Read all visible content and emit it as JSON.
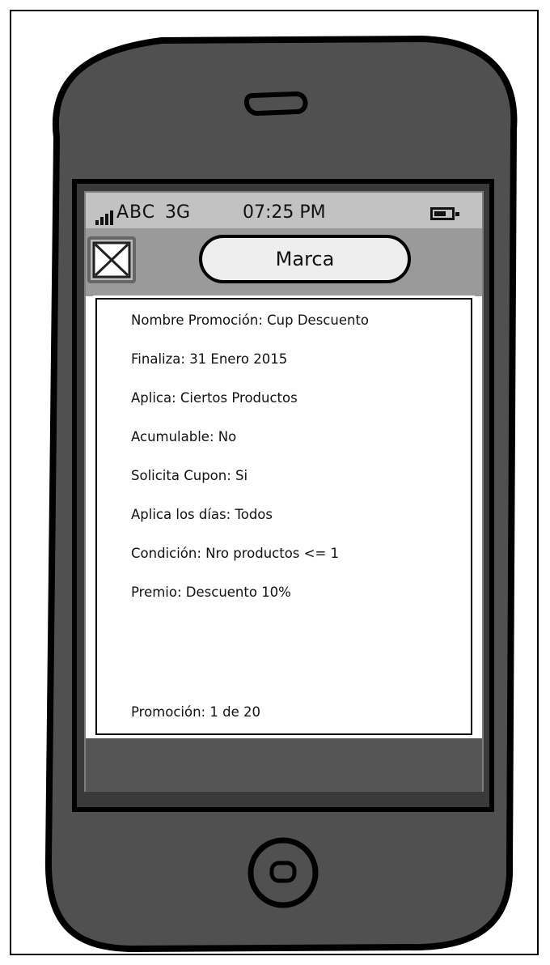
{
  "status_bar": {
    "carrier": "ABC",
    "network": "3G",
    "time": "07:25 PM"
  },
  "header": {
    "close_icon": "close-box-icon",
    "title": "Marca"
  },
  "promotion": {
    "fields": [
      "Nombre Promoción: Cup Descuento",
      "Finaliza: 31 Enero 2015",
      "Aplica: Ciertos Productos",
      "Acumulable: No",
      "Solicita Cupon: Si",
      "Aplica los días: Todos",
      "Condición: Nro productos <= 1",
      "Premio: Descuento 10%"
    ],
    "pagination": "Promoción: 1 de 20"
  },
  "colors": {
    "phone_body": "#505050",
    "screen_header": "#9a9a9a",
    "screen_border": "#111111"
  }
}
